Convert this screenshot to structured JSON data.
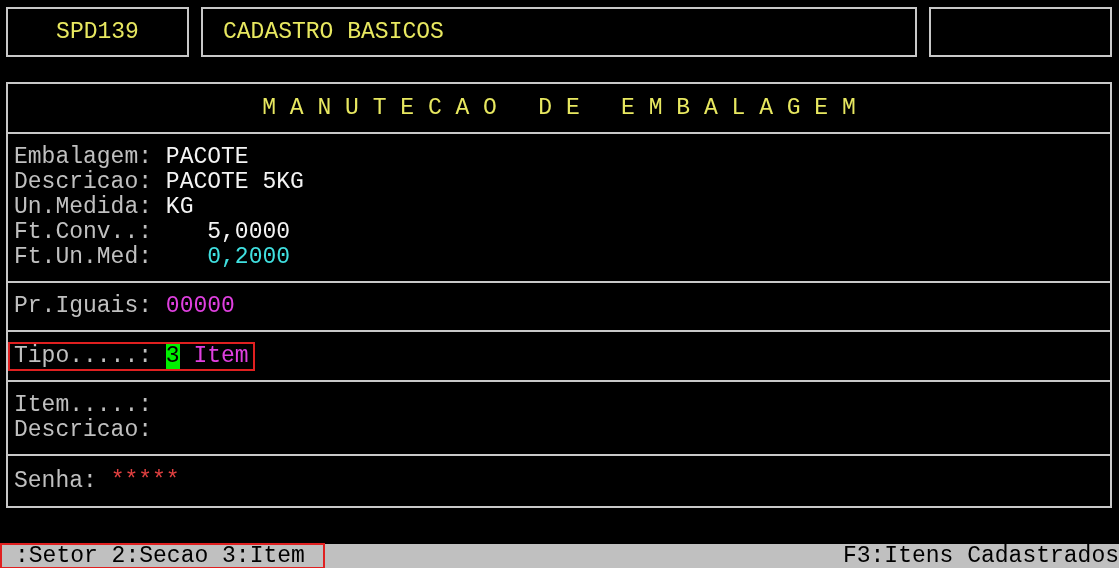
{
  "header": {
    "program_code": "SPD139",
    "module_title": "CADASTRO BASICOS"
  },
  "panel": {
    "title": "M A N U T E C A O   D E   E M B A L A G E M",
    "sections": [
      {
        "highlighted": false,
        "fields": [
          {
            "label": "Embalagem:",
            "value": "PACOTE",
            "kind": "text"
          },
          {
            "label": "Descricao:",
            "value": "PACOTE 5KG",
            "kind": "text"
          },
          {
            "label": "Un.Medida:",
            "value": "KG",
            "kind": "text"
          },
          {
            "label": "Ft.Conv..:",
            "value": "5,0000",
            "kind": "number"
          },
          {
            "label": "Ft.Un.Med:",
            "value": "0,2000",
            "kind": "computed"
          }
        ]
      },
      {
        "highlighted": false,
        "fields": [
          {
            "label": "Pr.Iguais:",
            "value": "00000",
            "kind": "count"
          }
        ]
      },
      {
        "highlighted": true,
        "fields": [
          {
            "label": "Tipo.....:",
            "code": "3",
            "value": "Item",
            "kind": "option"
          }
        ]
      },
      {
        "highlighted": false,
        "fields": [
          {
            "label": "Item.....:",
            "kind": "text"
          },
          {
            "label": "Descricao:",
            "kind": "text"
          }
        ]
      },
      {
        "highlighted": false,
        "fields": [
          {
            "label": "Senha:",
            "value": "*****",
            "kind": "password"
          }
        ]
      }
    ]
  },
  "status_bar": {
    "left": {
      "text": ":Setor 2:Secao 3:Item",
      "highlighted": true
    },
    "right": "F3:Itens Cadastrados"
  }
}
